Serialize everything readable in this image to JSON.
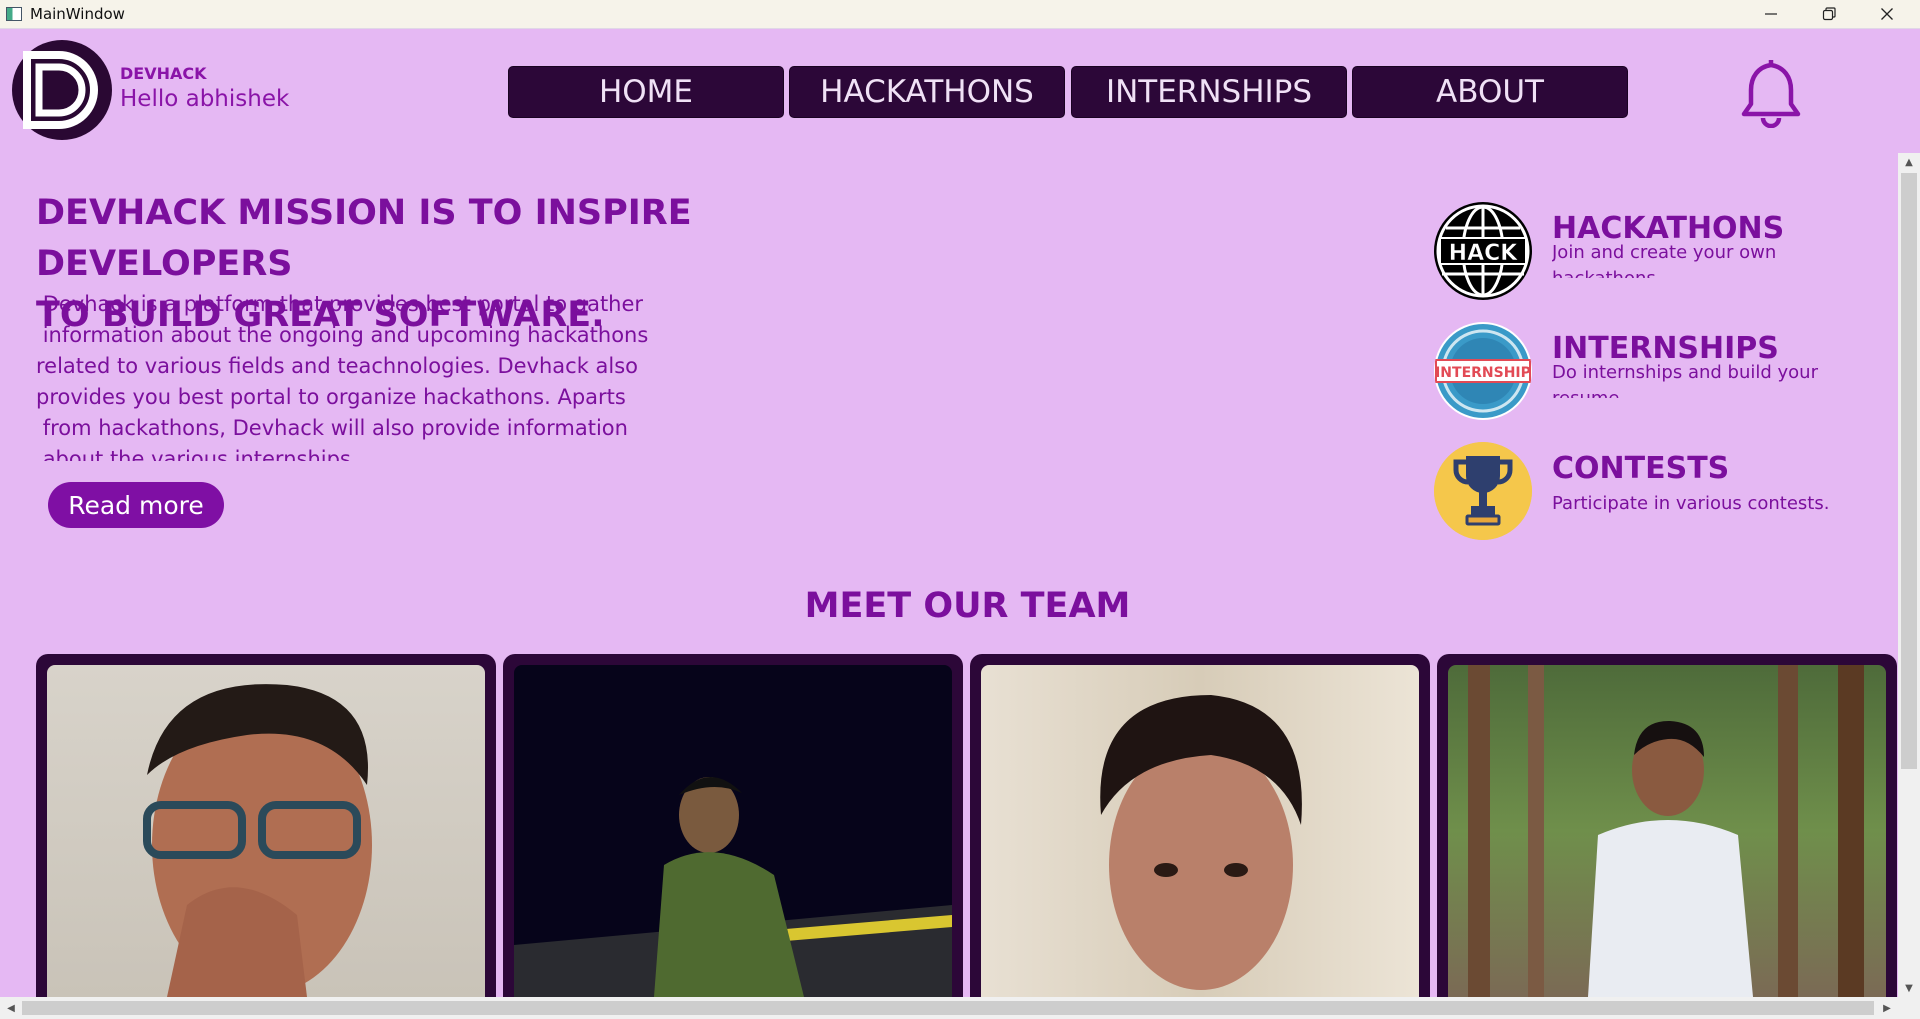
{
  "window": {
    "title": "MainWindow"
  },
  "header": {
    "brand": "DEVHACK",
    "greeting": "Hello abhishek",
    "nav": [
      {
        "label": "HOME"
      },
      {
        "label": "HACKATHONS"
      },
      {
        "label": "INTERNSHIPS"
      },
      {
        "label": "ABOUT"
      }
    ],
    "icons": {
      "logo": "devhack-logo-icon",
      "bell": "bell-icon"
    }
  },
  "mission": {
    "title_line1": "DEVHACK MISSION IS TO INSPIRE DEVELOPERS",
    "title_line2": "TO BUILD GREAT SOFTWARE.",
    "body": " Devhack is a platform that provides best portal to gather\n information about the ongoing and upcoming hackathons\nrelated to various fields and teachnologies. Devhack also\nprovides you best portal to organize hackathons. Aparts\n from hackathons, Devhack will also provide information\n about the various internships",
    "read_more": "Read more"
  },
  "features": [
    {
      "title": "HACKATHONS",
      "desc": "Join and create your own hackathons",
      "icon": "hack-globe-icon"
    },
    {
      "title": "INTERNSHIPS",
      "desc": "Do internships and build your resume",
      "icon": "internship-stamp-icon"
    },
    {
      "title": "CONTESTS",
      "desc": "Participate in various contests.",
      "icon": "trophy-icon"
    }
  ],
  "team": {
    "title": "MEET OUR TEAM"
  },
  "colors": {
    "background": "#e5b8f3",
    "accent": "#7b0f9d",
    "nav_bg": "#2c0738"
  }
}
